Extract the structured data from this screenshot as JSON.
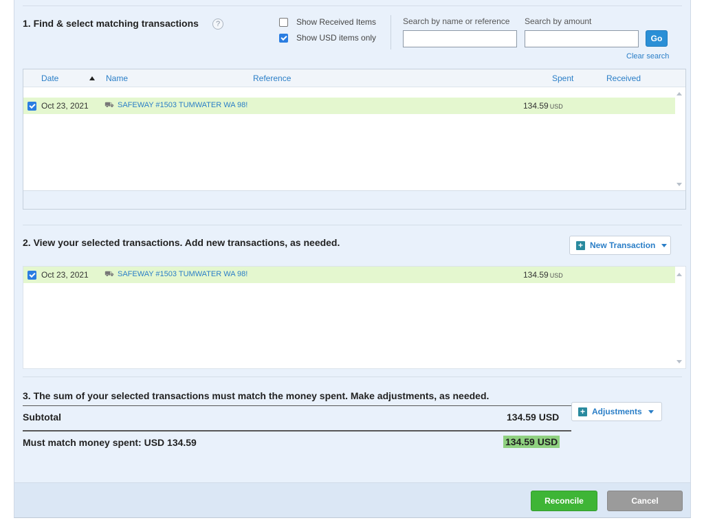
{
  "section1": {
    "title": "1. Find & select matching transactions",
    "help_icon": "?",
    "show_received": {
      "label": "Show Received Items",
      "checked": false
    },
    "show_usd": {
      "label": "Show USD items only",
      "checked": true
    },
    "search_name_label": "Search by name or reference",
    "search_amount_label": "Search by amount",
    "search_name_value": "",
    "search_amount_value": "",
    "go_label": "Go",
    "clear_label": "Clear search",
    "columns": {
      "date": "Date",
      "name": "Name",
      "reference": "Reference",
      "spent": "Spent",
      "received": "Received"
    },
    "rows": [
      {
        "checked": true,
        "date": "Oct 23, 2021",
        "name": "SAFEWAY #1503 TUMWATER WA 98!",
        "spent": "134.59",
        "currency": "USD"
      }
    ]
  },
  "section2": {
    "title": "2. View your selected transactions. Add new transactions, as needed.",
    "new_transaction_label": "New Transaction",
    "rows": [
      {
        "checked": true,
        "date": "Oct 23, 2021",
        "name": "SAFEWAY #1503 TUMWATER WA 98!",
        "spent": "134.59",
        "currency": "USD"
      }
    ]
  },
  "section3": {
    "title": "3. The sum of your selected transactions must match the money spent. Make adjustments, as needed.",
    "adjustments_label": "Adjustments",
    "subtotal_label": "Subtotal",
    "subtotal_value": "134.59 USD",
    "must_match_label": "Must match money spent: USD 134.59",
    "must_match_value": "134.59 USD"
  },
  "footer": {
    "reconcile_label": "Reconcile",
    "cancel_label": "Cancel"
  },
  "colors": {
    "accent": "#2a7ec7",
    "row_highlight": "#e4f7cf",
    "match_highlight": "#8fd180",
    "reconcile": "#3eb536",
    "cancel": "#9b9b9b"
  }
}
